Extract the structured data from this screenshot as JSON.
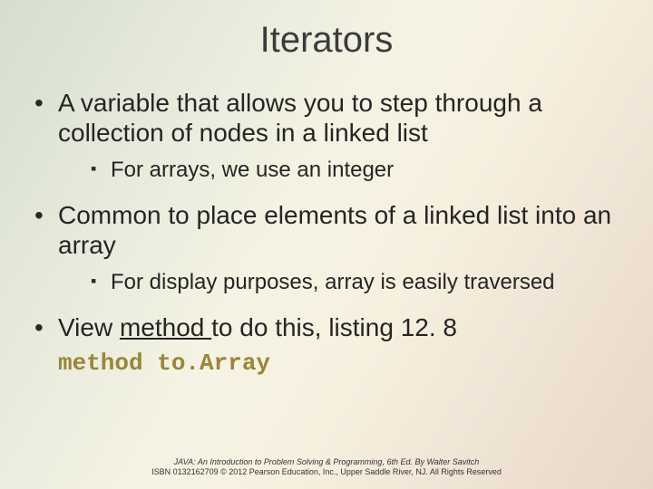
{
  "title": "Iterators",
  "bullets": {
    "b1": "A variable that allows you to step through a collection of nodes in a linked list",
    "b1_sub1": "For arrays, we use an integer",
    "b2": "Common to place elements of a linked list into an array",
    "b2_sub1": "For display purposes, array is easily traversed",
    "b3_pre": "View ",
    "b3_link": "method ",
    "b3_post": "to do this, listing 12. 8"
  },
  "code_line": "method to.Array",
  "footer": {
    "line1": "JAVA: An Introduction to Problem Solving & Programming, 6th Ed. By Walter Savitch",
    "line2": "ISBN 0132162709 © 2012 Pearson Education, Inc., Upper Saddle River, NJ. All Rights Reserved"
  }
}
